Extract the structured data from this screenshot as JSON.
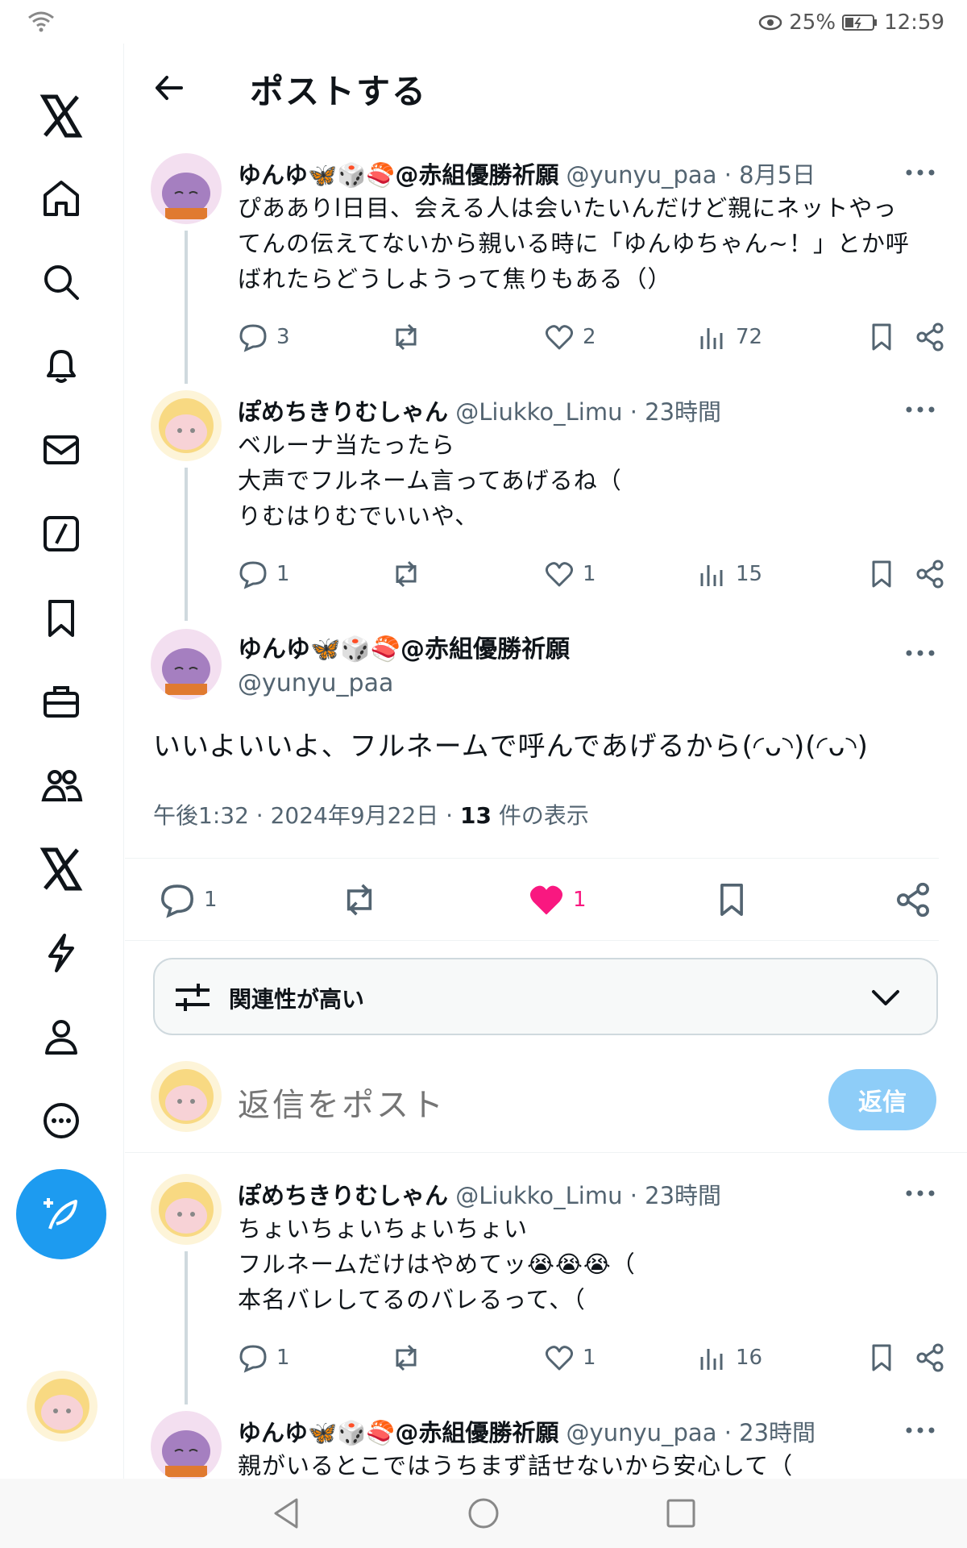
{
  "status_bar": {
    "battery": "25%",
    "time": "12:59"
  },
  "header": {
    "title": "ポストする"
  },
  "tweets": [
    {
      "name": "ゆんゆ🦋🎲🍣@赤組優勝祈願",
      "handle": "@yunyu_paa",
      "time": "· 8月5日",
      "text": "ぴあありl日目、会える人は会いたいんだけど親にネットやっ\nてんの伝えてないから親いる時に「ゆんゆちゃん~！」とか呼\nばれたらどうしようって焦りもある（）",
      "replies": "3",
      "likes": "2",
      "views": "72"
    },
    {
      "name": "ぽめちきりむしゃん",
      "handle": "@Liukko_Limu",
      "time": "· 23時間",
      "text": "ベルーナ当たったら\n大声でフルネーム言ってあげるね（\nりむはりむでいいや、",
      "replies": "1",
      "likes": "1",
      "views": "15"
    }
  ],
  "main_tweet": {
    "name": "ゆんゆ🦋🎲🍣@赤組優勝祈願",
    "handle": "@yunyu_paa",
    "text": "いいよいいよ、フルネームで呼んであげるから(◜ᴗ◝)(◜ᴗ◝)",
    "time": "午後1:32 · 2024年9月22日 · ",
    "views_count": "13",
    "views_label": " 件の表示",
    "replies": "1",
    "likes": "1"
  },
  "sort": {
    "label": "関連性が高い"
  },
  "reply": {
    "placeholder": "返信をポスト",
    "button": "返信"
  },
  "replies": [
    {
      "name": "ぽめちきりむしゃん",
      "handle": "@Liukko_Limu",
      "time": "· 23時間",
      "text": "ちょいちょいちょいちょい\nフルネームだけはやめてッ😭😭😭（\n本名バレしてるのバレるって、（",
      "replies": "1",
      "likes": "1",
      "views": "16"
    },
    {
      "name": "ゆんゆ🦋🎲🍣@赤組優勝祈願",
      "handle": "@yunyu_paa",
      "time": "· 23時間",
      "text": "親がいるとこではうちまず話せないから安心して（"
    }
  ],
  "colors": {
    "accent": "#1d9bf0",
    "like": "#f91880",
    "reply_btn": "#8ecdf8"
  }
}
